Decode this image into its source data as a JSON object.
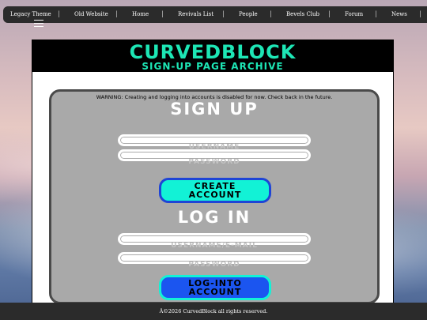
{
  "nav": {
    "items": [
      "Legacy Theme",
      "Old Website",
      "Home",
      "Revivals List",
      "People",
      "Bevels Club",
      "Forum",
      "News"
    ],
    "separator": "|"
  },
  "icons": {
    "menu": "hamburger-menu-icon"
  },
  "banner": {
    "title": "CURVEDBLOCK",
    "subtitle": "SIGN-UP PAGE ARCHIVE",
    "title_color": "#1de6b5"
  },
  "warning": "WARNING: Creating and logging into accounts is disabled for now. Check back in the future.",
  "signup": {
    "heading": "SIGN UP",
    "username_placeholder": "USERNAME",
    "password_placeholder": "PASSWORD",
    "button_line1": "CREATE",
    "button_line2": "ACCOUNT"
  },
  "login": {
    "heading": "LOG IN",
    "username_placeholder": "USERNAME/E-MAIL",
    "password_placeholder": "PASSWORD",
    "button_line1": "LOG-INTO",
    "button_line2": "ACCOUNT"
  },
  "footer": "Â©2026 CurvedBlock all rights reserved.",
  "colors": {
    "accent": "#12f2d6",
    "button_blue": "#1b55f0",
    "card_gray": "#a9a9a9"
  }
}
